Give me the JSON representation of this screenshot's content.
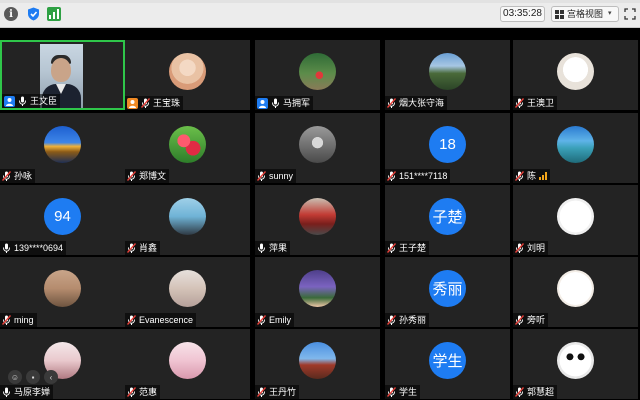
{
  "topbar": {
    "timer": "03:35:28",
    "view_label": "宫格视图",
    "view_caret": "▾"
  },
  "colors": {
    "tile_bg": "#232323",
    "active_border": "#2fc64a",
    "number_avatar": "#1e7cf2",
    "host_badge": "#1e7cf2",
    "cohost_badge": "#f08a24"
  },
  "tiles": [
    {
      "name": "王文臣",
      "kind": "video",
      "badge": "host",
      "muted": false,
      "active": true
    },
    {
      "name": "王宝珠",
      "kind": "photo",
      "photo": "guitar",
      "badge": "cohost",
      "muted": true
    },
    {
      "name": "马拥军",
      "kind": "photo",
      "photo": "park",
      "badge": "host",
      "muted": false
    },
    {
      "name": "烟大张守海",
      "kind": "photo",
      "photo": "mountain",
      "badge": "",
      "muted": true
    },
    {
      "name": "王澳卫",
      "kind": "photo",
      "photo": "sketch",
      "badge": "",
      "muted": true
    },
    {
      "name": "孙咏",
      "kind": "photo",
      "photo": "sunset",
      "badge": "",
      "muted": true
    },
    {
      "name": "郑博文",
      "kind": "photo",
      "photo": "flowers",
      "badge": "",
      "muted": true
    },
    {
      "name": "sunny",
      "kind": "photo",
      "photo": "man",
      "badge": "",
      "muted": true
    },
    {
      "name": "151****7118",
      "kind": "number",
      "text": "18",
      "badge": "",
      "muted": true
    },
    {
      "name": "陈",
      "kind": "photo",
      "photo": "lake",
      "badge": "",
      "muted": true,
      "signal": true
    },
    {
      "name": "139****0694",
      "kind": "number",
      "text": "94",
      "badge": "",
      "muted": false
    },
    {
      "name": "肖鑫",
      "kind": "photo",
      "photo": "girl-sea",
      "badge": "",
      "muted": true
    },
    {
      "name": "萍果",
      "kind": "photo",
      "photo": "train",
      "badge": "",
      "muted": false
    },
    {
      "name": "王子楚",
      "kind": "text",
      "text": "子楚",
      "badge": "",
      "muted": true
    },
    {
      "name": "刘明",
      "kind": "photo",
      "photo": "snoopy",
      "badge": "",
      "muted": true
    },
    {
      "name": "ming",
      "kind": "photo",
      "photo": "cat",
      "badge": "",
      "muted": true
    },
    {
      "name": "Evanescence",
      "kind": "photo",
      "photo": "anime-girl",
      "badge": "",
      "muted": true
    },
    {
      "name": "Emily",
      "kind": "photo",
      "photo": "lavender",
      "badge": "",
      "muted": true
    },
    {
      "name": "孙秀丽",
      "kind": "text",
      "text": "秀丽",
      "badge": "",
      "muted": true
    },
    {
      "name": "旁听",
      "kind": "photo",
      "photo": "cartoon",
      "badge": "",
      "muted": true
    },
    {
      "name": "马原李婵",
      "kind": "photo",
      "photo": "girl-pink",
      "badge": "",
      "muted": false
    },
    {
      "name": "范惠",
      "kind": "photo",
      "photo": "anime-pink",
      "badge": "",
      "muted": true
    },
    {
      "name": "王丹竹",
      "kind": "photo",
      "photo": "temple",
      "badge": "",
      "muted": true
    },
    {
      "name": "学生",
      "kind": "text",
      "text": "学生",
      "badge": "",
      "muted": true
    },
    {
      "name": "郭慧超",
      "kind": "photo",
      "photo": "panda",
      "badge": "",
      "muted": true
    }
  ]
}
